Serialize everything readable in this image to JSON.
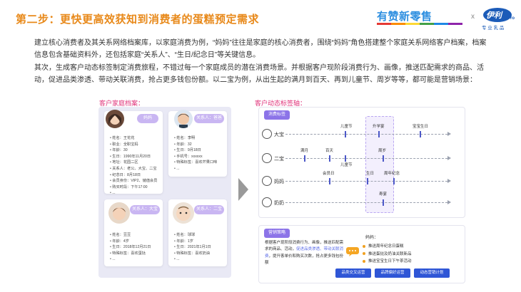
{
  "header": {
    "title": "第二步：更快更高效获知到消费者的蛋糕预定需求",
    "brand": "有赞新零售",
    "separator": "x",
    "logo": {
      "name": "伊利",
      "sub": "Pro",
      "tagline": "专 业 乳 品"
    }
  },
  "body": {
    "para1": "建立核心消费者及其关系网络档案库，以家庭消费为例，“妈妈”往往是家庭的核心消费者，围绕“妈妈”角色搭建整个家庭关系网络客户档案，档案信息包含基础资料外，还包括家庭“关系人”、“生日/纪念日”等关键信息。",
    "para2": "其次，生成客户动态标签制定消费旅程，不错过每一个家庭成员的潜在消费场景。并根据客户现阶段消费行为、画像，推送匹配需求的商品、活动，促进品类渗透、带动关联消费，抢占更多钱包份额。以二宝为例，从出生起的满月到百天、再到儿童节、周岁等等，都可能是营销场景："
  },
  "labels": {
    "left": "客户家庭档案：",
    "right": "客户动态标签轴："
  },
  "profiles": {
    "mama": {
      "tag": "妈妈",
      "fields": [
        "姓名：王花花",
        "职业：全职宝妈",
        "年龄：30",
        "生日：1990年11月20日",
        "地址：花园二区",
        "关系人：老公、大宝、二宝",
        "纪念日：8月18日",
        "会员身份：VIP2、储值会员",
        "购买时段：下午17:00",
        "..."
      ]
    },
    "dad": {
      "tag": "关系人：爸爸",
      "fields": [
        "姓名：李明",
        "年龄：32",
        "生日：9月18日",
        "手机号：xxxxxx",
        "特殊标签：喜欢芒果口味",
        "..."
      ]
    },
    "dabao": {
      "tag": "关系人：大宝",
      "fields": [
        "姓名：豆豆",
        "年龄：4岁",
        "生日：2018年12月21日",
        "特殊标签：喜欢蛋挞",
        "..."
      ]
    },
    "erbao": {
      "tag": "关系人：二宝",
      "fields": [
        "姓名：球球",
        "年龄：1岁",
        "生日：2021年1月1日",
        "特殊标签：喜欢奶油",
        "..."
      ]
    }
  },
  "timeline": {
    "tag": "消费标签",
    "rows": [
      {
        "label": "大宝",
        "events": [
          "儿童节",
          "升学宴",
          "宝宝生日"
        ]
      },
      {
        "label": "二宝",
        "events": [
          "满月",
          "百天",
          "儿童节",
          "周岁"
        ]
      },
      {
        "label": "妈妈",
        "events": [
          "会员日",
          "生日",
          "周年纪念"
        ]
      },
      {
        "label": "奶奶",
        "events": [
          "寿宴"
        ]
      }
    ]
  },
  "strategy": {
    "tag": "营销策略",
    "text_a": "根据客户现阶段消费行为、画像，推送匹配需求的商品、活动，",
    "text_hl": "促进品类渗透、带动关联消费",
    "text_b": "，提升客单价和购买次数，抢占更多钱包份额",
    "mama_title": "妈妈：",
    "bullets": [
      "推送周年纪念日蛋糕",
      "推送蛋挞及奶油关联新品",
      "推送宝宝生日下午茶活动"
    ],
    "buttons": [
      "品类交叉运营",
      "品牌偏好运营",
      "动态营销计划"
    ]
  },
  "colors": {
    "title": "#E8891A",
    "brand": "#2E8FE0",
    "accent_pink": "#E0337A",
    "tag_purple": "#8C74E8",
    "button_blue": "#2F56D6"
  }
}
